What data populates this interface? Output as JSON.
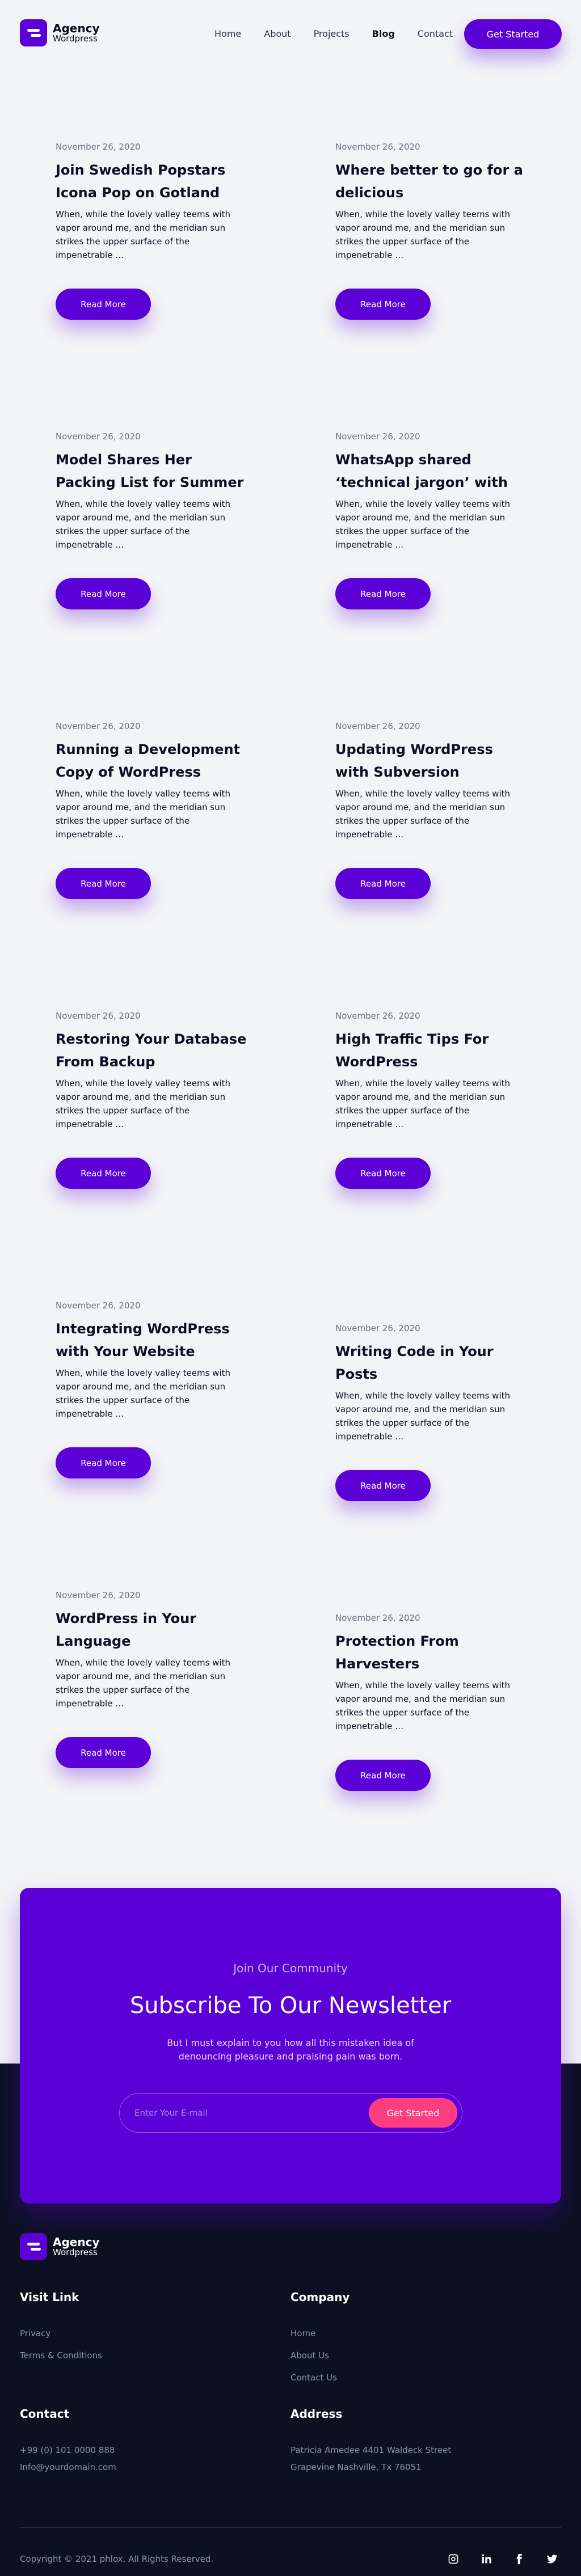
{
  "brand": {
    "name": "Agency",
    "tagline": "Wordpress"
  },
  "nav": {
    "items": [
      "Home",
      "About",
      "Projects",
      "Blog",
      "Contact"
    ],
    "active": "Blog"
  },
  "header": {
    "cta": "Get Started"
  },
  "posts": [
    {
      "date": "November 26, 2020",
      "title": "Join Swedish Popstars Icona Pop on Gotland",
      "excerpt": "When, while the lovely valley teems with vapor around me, and the meridian sun strikes the upper surface of the impenetrable …",
      "button": "Read More"
    },
    {
      "date": "November 26, 2020",
      "title": "Where better to go for a delicious",
      "excerpt": "When, while the lovely valley teems with vapor around me, and the meridian sun strikes the upper surface of the impenetrable …",
      "button": "Read More"
    },
    {
      "date": "November 26, 2020",
      "title": "Model Shares Her Packing List for Summer",
      "excerpt": "When, while the lovely valley teems with vapor around me, and the meridian sun strikes the upper surface of the impenetrable …",
      "button": "Read More"
    },
    {
      "date": "November 26, 2020",
      "title": "WhatsApp shared ‘technical jargon’ with",
      "excerpt": "When, while the lovely valley teems with vapor around me, and the meridian sun strikes the upper surface of the impenetrable …",
      "button": "Read More"
    },
    {
      "date": "November 26, 2020",
      "title": "Running a Development Copy of WordPress",
      "excerpt": "When, while the lovely valley teems with vapor around me, and the meridian sun strikes the upper surface of the impenetrable …",
      "button": "Read More"
    },
    {
      "date": "November 26, 2020",
      "title": "Updating WordPress with Subversion",
      "excerpt": "When, while the lovely valley teems with vapor around me, and the meridian sun strikes the upper surface of the impenetrable …",
      "button": "Read More"
    },
    {
      "date": "November 26, 2020",
      "title": "Restoring Your Database From Backup",
      "excerpt": "When, while the lovely valley teems with vapor around me, and the meridian sun strikes the upper surface of the impenetrable …",
      "button": "Read More"
    },
    {
      "date": "November 26, 2020",
      "title": "High Traffic Tips For WordPress",
      "excerpt": "When, while the lovely valley teems with vapor around me, and the meridian sun strikes the upper surface of the impenetrable …",
      "button": "Read More"
    },
    {
      "date": "November 26, 2020",
      "title": "Integrating WordPress with Your Website",
      "excerpt": "When, while the lovely valley teems with vapor around me, and the meridian sun strikes the upper surface of the impenetrable …",
      "button": "Read More"
    },
    {
      "date": "November 26, 2020",
      "title": "Writing Code in Your Posts",
      "excerpt": "When, while the lovely valley teems with vapor around me, and the meridian sun strikes the upper surface of the impenetrable …",
      "button": "Read More"
    },
    {
      "date": "November 26, 2020",
      "title": "WordPress in Your Language",
      "excerpt": "When, while the lovely valley teems with vapor around me, and the meridian sun strikes the upper surface of the impenetrable …",
      "button": "Read More"
    },
    {
      "date": "November 26, 2020",
      "title": "Protection From Harvesters",
      "excerpt": "When, while the lovely valley teems with vapor around me, and the meridian sun strikes the upper surface of the impenetrable …",
      "button": "Read More"
    }
  ],
  "newsletter": {
    "kicker": "Join Our Community",
    "title": "Subscribe To Our Newsletter",
    "text": "But I must explain to you how all this mistaken idea of denouncing pleasure and praising pain was born.",
    "placeholder": "Enter Your E-mail",
    "button": "Get Started"
  },
  "footer": {
    "visit_link": {
      "heading": "Visit Link",
      "items": [
        "Privacy",
        "Terms & Conditions"
      ]
    },
    "company": {
      "heading": "Company",
      "items": [
        "Home",
        "About Us",
        "Contact Us"
      ]
    },
    "contact": {
      "heading": "Contact",
      "phone": "+99 (0) 101 0000 888",
      "email": "Info@yourdomain.com"
    },
    "address": {
      "heading": "Address",
      "line1": "Patricia Amedee 4401 Waldeck Street",
      "line2": "Grapevine Nashville, Tx 76051"
    },
    "copyright": "Copyright © 2021 phlox. All Rights Reserved.",
    "socials": [
      "instagram-icon",
      "linkedin-icon",
      "facebook-icon",
      "twitter-icon"
    ]
  },
  "colors": {
    "accent": "#5c00d8",
    "cta_pink": "#ff3d7f",
    "footer_bg": "#0b1121",
    "page_bg": "#f3f4f7"
  }
}
